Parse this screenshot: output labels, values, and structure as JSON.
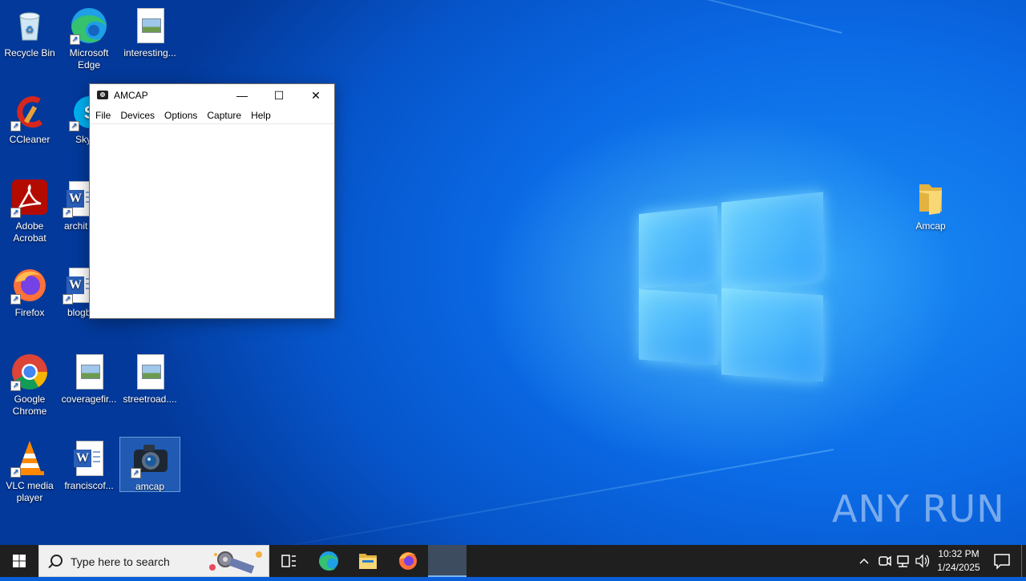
{
  "desktop": {
    "icons": [
      {
        "label": "Recycle Bin"
      },
      {
        "label": "Microsoft Edge"
      },
      {
        "label": "interesting..."
      },
      {
        "label": "CCleaner"
      },
      {
        "label": "Sky"
      },
      {
        "label": "Adobe Acrobat"
      },
      {
        "label": "archit"
      },
      {
        "label": "Firefox"
      },
      {
        "label": "blogb"
      },
      {
        "label": "Google Chrome"
      },
      {
        "label": "coveragefir..."
      },
      {
        "label": "streetroad...."
      },
      {
        "label": "VLC media player"
      },
      {
        "label": "franciscof..."
      },
      {
        "label": "amcap"
      },
      {
        "label": "Amcap"
      }
    ]
  },
  "window": {
    "title": "AMCAP",
    "controls": {
      "minimize": "—",
      "maximize": "☐",
      "close": "✕"
    },
    "menu": [
      "File",
      "Devices",
      "Options",
      "Capture",
      "Help"
    ]
  },
  "taskbar": {
    "search_placeholder": "Type here to search",
    "time": "10:32 PM",
    "date": "1/24/2025"
  },
  "watermark": "ANY RUN",
  "colors": {
    "taskbar": "#1f1f1f",
    "desktop_blue": "#0b6be6",
    "active_task": "#3d4c5e"
  }
}
